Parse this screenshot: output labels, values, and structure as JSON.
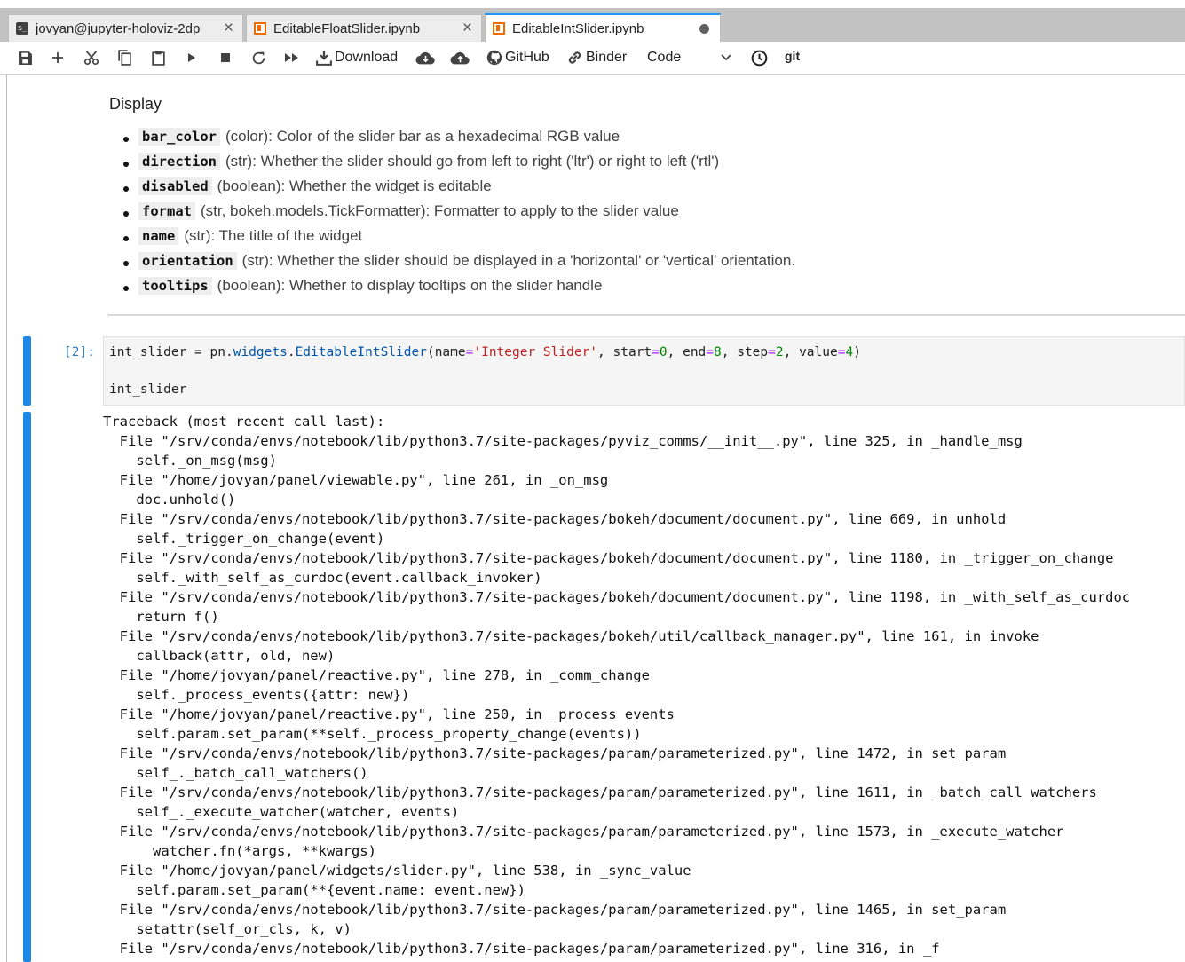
{
  "tabs": [
    {
      "label": "jovyan@jupyter-holoviz-2dp",
      "icon": "terminal-icon",
      "state": "close"
    },
    {
      "label": "EditableFloatSlider.ipynb",
      "icon": "notebook-icon",
      "state": "close"
    },
    {
      "label": "EditableIntSlider.ipynb",
      "icon": "notebook-icon",
      "state": "modified"
    }
  ],
  "toolbar": {
    "download_label": "Download",
    "github_label": "GitHub",
    "binder_label": "Binder",
    "cell_type": "Code",
    "git_label": "git"
  },
  "markdown": {
    "title": "Display",
    "items": [
      {
        "code": "bar_color",
        "text": "(color): Color of the slider bar as a hexadecimal RGB value"
      },
      {
        "code": "direction",
        "text": "(str): Whether the slider should go from left to right ('ltr') or right to left ('rtl')"
      },
      {
        "code": "disabled",
        "text": "(boolean): Whether the widget is editable"
      },
      {
        "code": "format",
        "text": "(str, bokeh.models.TickFormatter): Formatter to apply to the slider value"
      },
      {
        "code": "name",
        "text": "(str): The title of the widget"
      },
      {
        "code": "orientation",
        "text": "(str): Whether the slider should be displayed in a 'horizontal' or 'vertical' orientation."
      },
      {
        "code": "tooltips",
        "text": "(boolean): Whether to display tooltips on the slider handle"
      }
    ]
  },
  "cell": {
    "prompt": "[2]:",
    "line1": {
      "var": "int_slider",
      "assign": " = ",
      "mod": "pn",
      "dot1": ".",
      "attr1": "widgets",
      "dot2": ".",
      "attr2": "EditableIntSlider",
      "open": "(name",
      "eq1": "=",
      "name_val": "'Integer Slider'",
      "c1": ", start",
      "eq2": "=",
      "start_val": "0",
      "c2": ", end",
      "eq3": "=",
      "end_val": "8",
      "c3": ", step",
      "eq4": "=",
      "step_val": "2",
      "c4": ", value",
      "eq5": "=",
      "value_val": "4",
      "close": ")"
    },
    "line2": "int_slider"
  },
  "traceback": [
    "Traceback (most recent call last):",
    "  File \"/srv/conda/envs/notebook/lib/python3.7/site-packages/pyviz_comms/__init__.py\", line 325, in _handle_msg",
    "    self._on_msg(msg)",
    "  File \"/home/jovyan/panel/viewable.py\", line 261, in _on_msg",
    "    doc.unhold()",
    "  File \"/srv/conda/envs/notebook/lib/python3.7/site-packages/bokeh/document/document.py\", line 669, in unhold",
    "    self._trigger_on_change(event)",
    "  File \"/srv/conda/envs/notebook/lib/python3.7/site-packages/bokeh/document/document.py\", line 1180, in _trigger_on_change",
    "    self._with_self_as_curdoc(event.callback_invoker)",
    "  File \"/srv/conda/envs/notebook/lib/python3.7/site-packages/bokeh/document/document.py\", line 1198, in _with_self_as_curdoc",
    "    return f()",
    "  File \"/srv/conda/envs/notebook/lib/python3.7/site-packages/bokeh/util/callback_manager.py\", line 161, in invoke",
    "    callback(attr, old, new)",
    "  File \"/home/jovyan/panel/reactive.py\", line 278, in _comm_change",
    "    self._process_events({attr: new})",
    "  File \"/home/jovyan/panel/reactive.py\", line 250, in _process_events",
    "    self.param.set_param(**self._process_property_change(events))",
    "  File \"/srv/conda/envs/notebook/lib/python3.7/site-packages/param/parameterized.py\", line 1472, in set_param",
    "    self_._batch_call_watchers()",
    "  File \"/srv/conda/envs/notebook/lib/python3.7/site-packages/param/parameterized.py\", line 1611, in _batch_call_watchers",
    "    self_._execute_watcher(watcher, events)",
    "  File \"/srv/conda/envs/notebook/lib/python3.7/site-packages/param/parameterized.py\", line 1573, in _execute_watcher",
    "      watcher.fn(*args, **kwargs)",
    "  File \"/home/jovyan/panel/widgets/slider.py\", line 538, in _sync_value",
    "    self.param.set_param(**{event.name: event.new})",
    "  File \"/srv/conda/envs/notebook/lib/python3.7/site-packages/param/parameterized.py\", line 1465, in set_param",
    "    setattr(self_or_cls, k, v)",
    "  File \"/srv/conda/envs/notebook/lib/python3.7/site-packages/param/parameterized.py\", line 316, in _f"
  ]
}
